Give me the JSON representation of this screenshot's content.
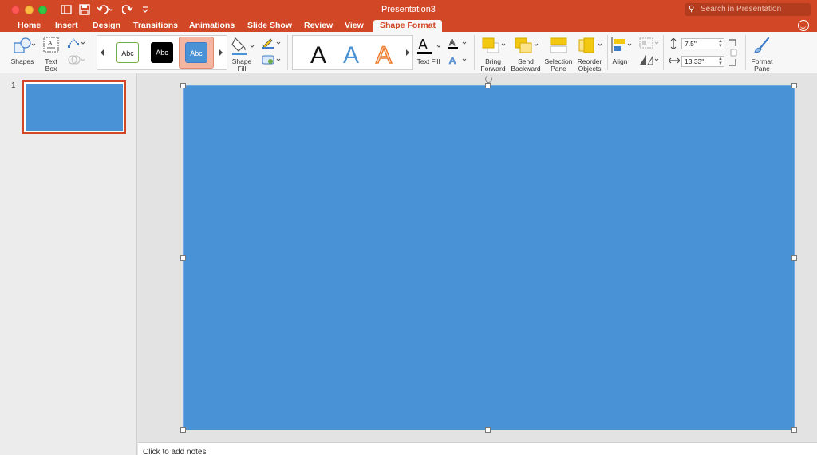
{
  "window": {
    "title": "Presentation3",
    "search_placeholder": "Search in Presentation"
  },
  "tabs": [
    {
      "label": "Home"
    },
    {
      "label": "Insert"
    },
    {
      "label": "Design"
    },
    {
      "label": "Transitions"
    },
    {
      "label": "Animations"
    },
    {
      "label": "Slide Show"
    },
    {
      "label": "Review"
    },
    {
      "label": "View"
    },
    {
      "label": "Shape Format",
      "active": true
    }
  ],
  "ribbon": {
    "shapes": "Shapes",
    "text_box_1": "Text",
    "text_box_2": "Box",
    "style_swatches": [
      "Abc",
      "Abc",
      "Abc"
    ],
    "shape_fill_1": "Shape",
    "shape_fill_2": "Fill",
    "wordart": [
      "A",
      "A",
      "A"
    ],
    "text_fill": "Text Fill",
    "bring_forward_1": "Bring",
    "bring_forward_2": "Forward",
    "send_backward_1": "Send",
    "send_backward_2": "Backward",
    "selection_pane_1": "Selection",
    "selection_pane_2": "Pane",
    "reorder_objects_1": "Reorder",
    "reorder_objects_2": "Objects",
    "align": "Align",
    "height_value": "7.5\"",
    "width_value": "13.33\"",
    "format_pane_1": "Format",
    "format_pane_2": "Pane"
  },
  "thumbnails": [
    {
      "number": "1"
    }
  ],
  "notes_placeholder": "Click to add notes",
  "colors": {
    "accent": "#d24726",
    "slide_fill": "#4a92d6"
  }
}
